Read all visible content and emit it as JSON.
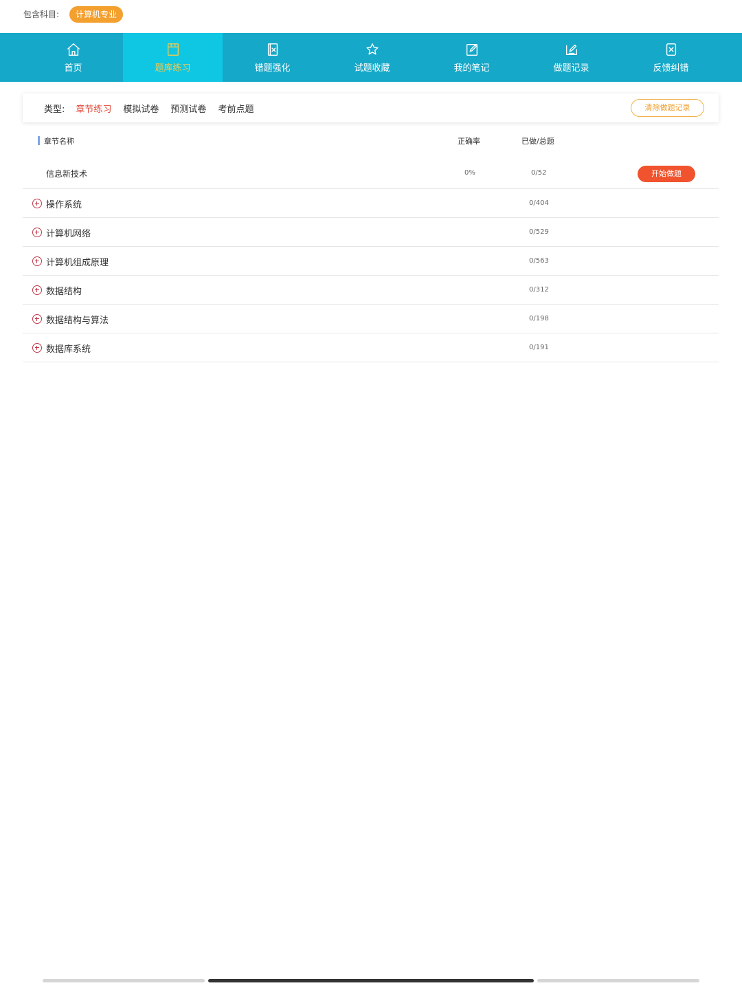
{
  "header": {
    "subject_label": "包含科目:",
    "subject_badge": "计算机专业"
  },
  "nav": [
    {
      "label": "首页",
      "icon": "home-icon",
      "active": false
    },
    {
      "label": "题库练习",
      "icon": "book-icon",
      "active": true
    },
    {
      "label": "错题强化",
      "icon": "wrong-doc-icon",
      "active": false
    },
    {
      "label": "试题收藏",
      "icon": "star-icon",
      "active": false
    },
    {
      "label": "我的笔记",
      "icon": "edit-note-icon",
      "active": false
    },
    {
      "label": "做题记录",
      "icon": "record-icon",
      "active": false
    },
    {
      "label": "反馈纠错",
      "icon": "feedback-icon",
      "active": false
    }
  ],
  "types": {
    "label": "类型:",
    "tabs": [
      "章节练习",
      "模拟试卷",
      "预测试卷",
      "考前点题"
    ],
    "active_index": 0,
    "clear_button": "清除做题记录"
  },
  "table": {
    "headers": {
      "name": "章节名称",
      "rate": "正确率",
      "done": "已做/总题"
    },
    "first_row": {
      "name": "信息新技术",
      "rate": "0%",
      "done": "0/52",
      "button": "开始做题"
    },
    "rows": [
      {
        "name": "操作系统",
        "done": "0/404"
      },
      {
        "name": "计算机网络",
        "done": "0/529"
      },
      {
        "name": "计算机组成原理",
        "done": "0/563"
      },
      {
        "name": "数据结构",
        "done": "0/312"
      },
      {
        "name": "数据结构与算法",
        "done": "0/198"
      },
      {
        "name": "数据库系统",
        "done": "0/191"
      }
    ]
  },
  "colors": {
    "nav_bg": "#16a8c8",
    "nav_active_bg": "#0fc6e3",
    "badge": "#f3a02f",
    "start_button": "#f0532d",
    "active_tab": "#e04a3b"
  }
}
